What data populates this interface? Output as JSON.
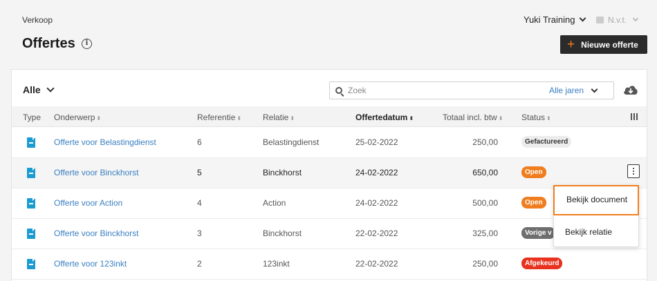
{
  "header": {
    "breadcrumb": "Verkoop",
    "title": "Offertes",
    "info_icon": "i",
    "company": "Yuki Training",
    "period": "N.v.t.",
    "new_button": "Nieuwe offerte",
    "new_button_icon": "+"
  },
  "toolbar": {
    "filter": "Alle",
    "search_placeholder": "Zoek",
    "year_filter": "Alle jaren"
  },
  "columns": {
    "type": "Type",
    "subject": "Onderwerp",
    "reference": "Referentie",
    "relation": "Relatie",
    "date": "Offertedatum",
    "total": "Totaal incl. btw",
    "status": "Status"
  },
  "sort_icon": "⬍",
  "rows": [
    {
      "subject": "Offerte voor Belastingdienst",
      "reference": "6",
      "relation": "Belastingdienst",
      "date": "25-02-2022",
      "total": "250,00",
      "status": "Gefactureerd"
    },
    {
      "subject": "Offerte voor Binckhorst",
      "reference": "5",
      "relation": "Binckhorst",
      "date": "24-02-2022",
      "total": "650,00",
      "status": "Open"
    },
    {
      "subject": "Offerte voor Action",
      "reference": "4",
      "relation": "Action",
      "date": "24-02-2022",
      "total": "500,00",
      "status": "Open"
    },
    {
      "subject": "Offerte voor Binckhorst",
      "reference": "3",
      "relation": "Binckhorst",
      "date": "22-02-2022",
      "total": "325,00",
      "status": "Vorige v"
    },
    {
      "subject": "Offerte voor 123inkt",
      "reference": "2",
      "relation": "123inkt",
      "date": "22-02-2022",
      "total": "250,00",
      "status": "Afgekeurd"
    }
  ],
  "context_menu": {
    "view_document": "Bekijk document",
    "view_relation": "Bekijk relatie"
  },
  "colors": {
    "accent": "#f07d1e",
    "link": "#3a7fc1",
    "icon_blue": "#1c9bd1",
    "rejected": "#e8321f"
  }
}
